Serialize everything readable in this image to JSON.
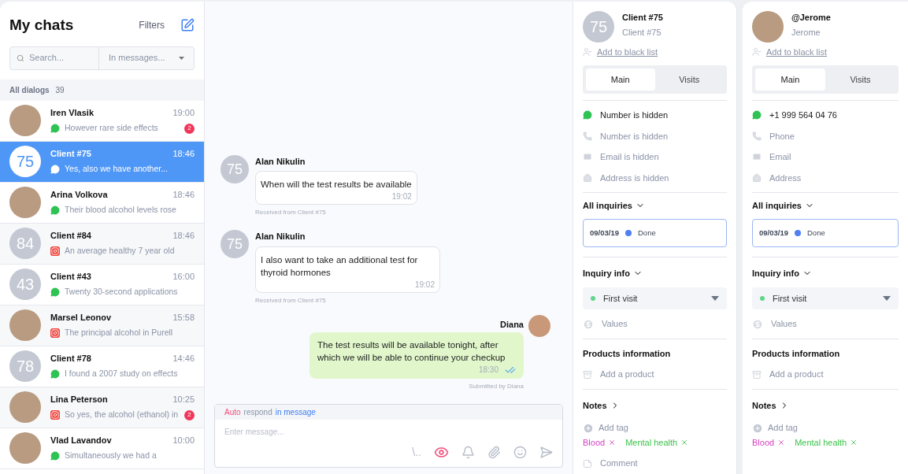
{
  "sidebar": {
    "title": "My chats",
    "filters": "Filters",
    "search": {
      "placeholder": "Search..."
    },
    "scope": {
      "value": "In messages..."
    },
    "group": {
      "label": "All dialogs",
      "count": "39"
    },
    "chats": [
      {
        "name": "Iren Vlasik",
        "time": "19:00",
        "preview": "However rare side effects",
        "kind": "whatsapp",
        "avatar": {
          "kind": "photo"
        },
        "badge": "2",
        "selected": false
      },
      {
        "name": "Client #75",
        "time": "18:46",
        "preview": "Yes, also we have another...",
        "kind": "whatsapp",
        "avatar": {
          "kind": "number",
          "text": "75"
        },
        "selected": true
      },
      {
        "name": "Arina Volkova",
        "time": "18:46",
        "preview": "Their blood alcohol levels rose",
        "kind": "whatsapp",
        "avatar": {
          "kind": "photo"
        },
        "selected": false
      },
      {
        "name": "Client #84",
        "time": "18:46",
        "preview": "An average healthy 7 year old",
        "kind": "instagram",
        "avatar": {
          "kind": "number",
          "text": "84"
        },
        "selected": false
      },
      {
        "name": "Client #43",
        "time": "16:00",
        "preview": "Twenty 30-second applications",
        "kind": "whatsapp",
        "avatar": {
          "kind": "number",
          "text": "43"
        },
        "selected": false
      },
      {
        "name": "Marsel Leonov",
        "time": "15:58",
        "preview": "The principal alcohol in Purell",
        "kind": "instagram",
        "avatar": {
          "kind": "photo"
        },
        "selected": false
      },
      {
        "name": "Client #78",
        "time": "14:46",
        "preview": "I found a 2007 study on effects",
        "kind": "whatsapp",
        "avatar": {
          "kind": "number",
          "text": "78"
        },
        "selected": false
      },
      {
        "name": "Lina Peterson",
        "time": "10:25",
        "preview": "So yes, the alcohol (ethanol) in",
        "kind": "instagram",
        "avatar": {
          "kind": "photo"
        },
        "badge": "2",
        "selected": false
      },
      {
        "name": "Vlad Lavandov",
        "time": "10:00",
        "preview": "Simultaneously we had a",
        "kind": "whatsapp",
        "avatar": {
          "kind": "photo"
        },
        "selected": false
      }
    ]
  },
  "conversation": {
    "messages": [
      {
        "kind": "incoming",
        "author": "Alan Nikulin",
        "avatar": "75",
        "text": "When will the test results be available",
        "time": "19:02",
        "note": "Received from Client #75"
      },
      {
        "kind": "incoming",
        "author": "Alan Nikulin",
        "avatar": "75",
        "text": "I also want to take an additional test for thyroid hormones",
        "time": "19:02",
        "note": "Received from Client #75"
      },
      {
        "kind": "outgoing",
        "author": "Diana",
        "text": "The test results will be available tonight, after which we will be able to continue your checkup",
        "time": "18:30",
        "read": true,
        "note": "Submitted by Diana"
      }
    ],
    "composer": {
      "mode": [
        {
          "text": "Auto",
          "color": "#f0507a"
        },
        {
          "text": "respond",
          "color": "#8a93a6"
        },
        {
          "text": "in message",
          "color": "#3d7ff2"
        }
      ],
      "placeholder": "Enter message...",
      "slash": "\\.."
    }
  },
  "profiles": [
    {
      "avatar": {
        "kind": "number",
        "text": "75"
      },
      "name": "Client #75",
      "subname": "Client #75",
      "blacklist": "Add to black list",
      "tabs": [
        {
          "label": "Main",
          "selected": true
        },
        {
          "label": "Visits",
          "selected": false
        }
      ],
      "contacts": [
        {
          "kind": "whatsapp",
          "text": "Number is hidden",
          "filled": true
        },
        {
          "kind": "phone",
          "text": "Number is hidden",
          "filled": false
        },
        {
          "kind": "email",
          "text": "Email is hidden",
          "filled": false
        },
        {
          "kind": "address",
          "text": "Address is hidden",
          "filled": false
        }
      ],
      "inquiries": {
        "title": "All inquiries",
        "date": "09/03/19",
        "status": "Done"
      },
      "info": {
        "title": "Inquiry info",
        "visit": "First visit",
        "values": "Values"
      },
      "products": {
        "title": "Products information",
        "add": "Add a product"
      },
      "notes": {
        "title": "Notes",
        "add_tag": "Add tag",
        "tags": [
          {
            "text": "Blood",
            "color": "#d63fc1"
          },
          {
            "text": "Mental health",
            "color": "#3cc24a"
          }
        ],
        "comment": "Comment"
      }
    },
    {
      "avatar": {
        "kind": "photo"
      },
      "name": "@Jerome",
      "subname": "Jerome",
      "blacklist": "Add to black list",
      "tabs": [
        {
          "label": "Main",
          "selected": true
        },
        {
          "label": "Visits",
          "selected": false
        }
      ],
      "contacts": [
        {
          "kind": "whatsapp",
          "text": "+1 999 564 04 76",
          "filled": true
        },
        {
          "kind": "phone",
          "text": "Phone",
          "filled": false
        },
        {
          "kind": "email",
          "text": "Email",
          "filled": false
        },
        {
          "kind": "address",
          "text": "Address",
          "filled": false
        }
      ],
      "inquiries": {
        "title": "All inquiries",
        "date": "09/03/19",
        "status": "Done"
      },
      "info": {
        "title": "Inquiry info",
        "visit": "First visit",
        "values": "Values"
      },
      "products": {
        "title": "Products information",
        "add": "Add a product"
      },
      "notes": {
        "title": "Notes",
        "add_tag": "Add tag",
        "tags": [
          {
            "text": "Blood",
            "color": "#d63fc1"
          },
          {
            "text": "Mental health",
            "color": "#3cc24a"
          }
        ]
      }
    }
  ]
}
